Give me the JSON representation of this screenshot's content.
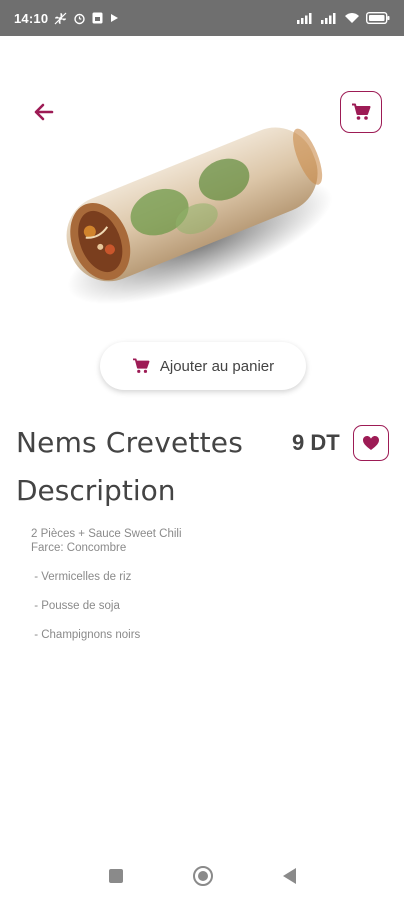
{
  "status_bar": {
    "time": "14:10",
    "left_icons": [
      "fan-icon",
      "alarm-icon",
      "sim-icon",
      "play-icon"
    ],
    "right_icons": [
      "signal-icon",
      "signal-icon",
      "wifi-icon",
      "battery-icon"
    ]
  },
  "header": {
    "back_icon": "arrow-left-icon",
    "cart_icon": "cart-icon"
  },
  "product": {
    "name": "Nems Crevettes",
    "price": "9 DT",
    "image_alt": "nem-roll-image"
  },
  "actions": {
    "add_to_cart_label": "Ajouter au panier",
    "favorite_icon": "heart-icon"
  },
  "description": {
    "title": "Description",
    "lines": [
      "2 Pièces + Sauce Sweet Chili",
      "Farce: Concombre",
      " - Vermicelles de riz",
      " - Pousse de soja",
      " - Champignons noirs"
    ]
  },
  "colors": {
    "accent": "#9d1b55",
    "status_bar": "#6f6f6f"
  }
}
